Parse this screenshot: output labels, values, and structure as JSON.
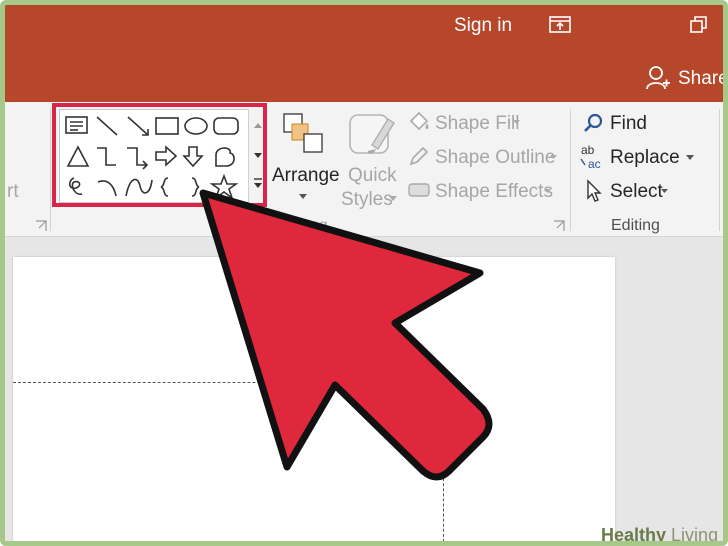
{
  "titlebar": {
    "sign_in": "Sign in",
    "share": "Share"
  },
  "ribbon": {
    "partial_left": "rt",
    "arrange_label": "Arrange",
    "quick_label": "Quick",
    "styles_label": "Styles",
    "shape_fill": "Shape Fill",
    "shape_outline": "Shape Outline",
    "shape_effects": "Shape Effects",
    "find": "Find",
    "replace": "Replace",
    "select": "Select",
    "editing_group": "Editing",
    "drawing_group_partial": "ng"
  },
  "watermark": {
    "brand": "Healthy",
    "suffix": "Living"
  },
  "colors": {
    "title_bg": "#b7472a",
    "highlight": "#d9254a",
    "arrow": "#e0283d"
  }
}
